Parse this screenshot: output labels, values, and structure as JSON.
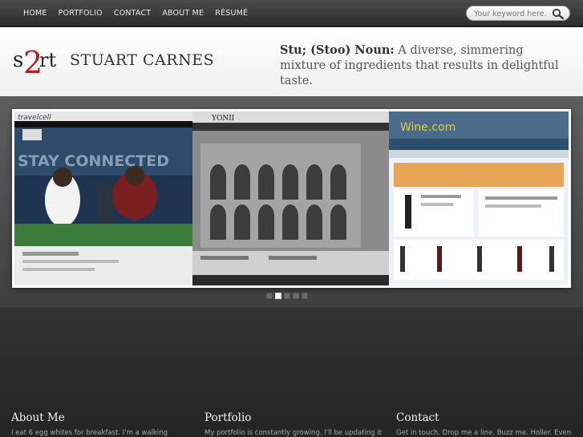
{
  "nav": {
    "items": [
      {
        "label": "HOME"
      },
      {
        "label": "PORTFOLIO"
      },
      {
        "label": "CONTACT"
      },
      {
        "label": "ABOUT ME"
      },
      {
        "label": "RÉSUMÉ"
      }
    ]
  },
  "search": {
    "placeholder": "Your keyword here.",
    "icon": "search-icon"
  },
  "header": {
    "logo_text": "s2rt",
    "brand": "STUART CARNES",
    "tagline_term": "Stu; (Stoo) Noun:",
    "tagline_def": " A diverse, simmering mixture of ingredients that results in delightful taste."
  },
  "slider": {
    "slides": [
      {
        "label": "travelcell",
        "banner": "STAY CONNECTED"
      },
      {
        "label": "YONII"
      },
      {
        "label": "Wine.com"
      }
    ],
    "active_index": 1,
    "dot_count": 5
  },
  "sections": [
    {
      "title": "About Me",
      "text": "I eat 6 egg whites for breakfast. I'm a walking"
    },
    {
      "title": "Portfolio",
      "text": "My portfolio is constantly growing. I'll be updating it"
    },
    {
      "title": "Contact",
      "text": "Get in touch. Drop me a line. Buzz me. Holler. Even"
    }
  ],
  "colors": {
    "topbar": "#3a3a3a",
    "band": "#4e4e4e",
    "footer": "#2a2a2a"
  }
}
